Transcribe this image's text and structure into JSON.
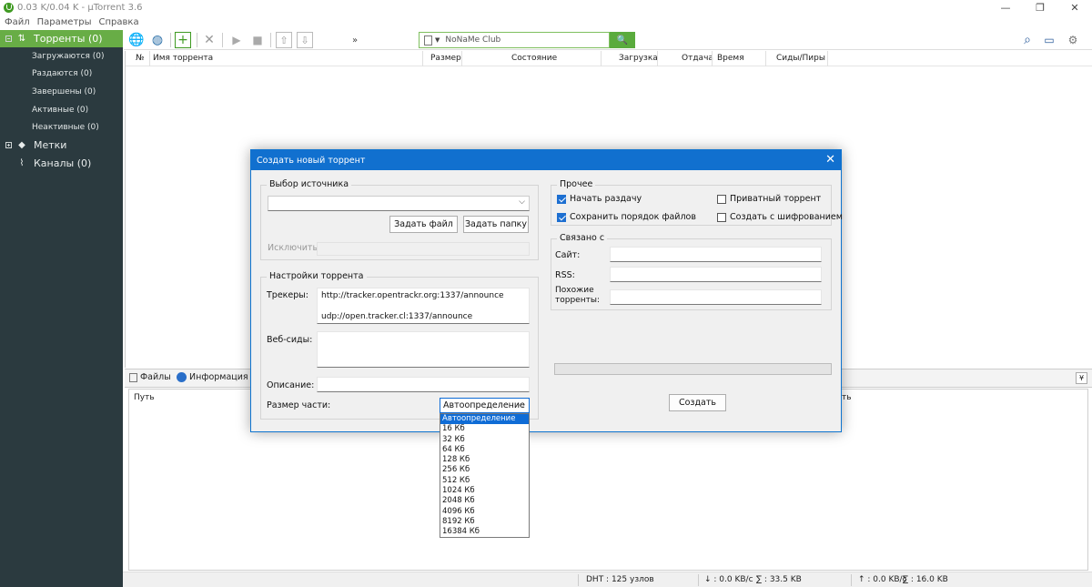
{
  "window": {
    "title": "0.03 K/0.04 K - µTorrent 3.6",
    "controls": [
      "—",
      "❐",
      "✕"
    ]
  },
  "menu": [
    "Файл",
    "Параметры",
    "Справка"
  ],
  "sidebar": {
    "torrents": "Торренты (0)",
    "subitems": [
      "Загружаются (0)",
      "Раздаются (0)",
      "Завершены (0)",
      "Активные (0)",
      "Неактивные (0)"
    ],
    "labels": "Метки",
    "feeds": "Каналы (0)"
  },
  "toolbar": {
    "search_value": "NoNaMe Club",
    "more": "»"
  },
  "list_columns": [
    "№",
    "Имя торрента",
    "Размер",
    "Состояние",
    "Загрузка",
    "Отдача",
    "Время",
    "Сиды/Пиры"
  ],
  "bottom_tabs": [
    "Файлы",
    "Информация"
  ],
  "files_columns": [
    "Путь",
    "ть"
  ],
  "status": {
    "dht": "DHT : 125 узлов",
    "down": "↓ : 0.0 KB/с",
    "down_total": "∑ : 33.5 KB",
    "up": "↑ : 0.0 KB/с",
    "up_total": "∑ : 16.0 KB"
  },
  "dialog": {
    "title": "Создать новый торрент",
    "source_group": "Выбор источника",
    "source_value": "",
    "btn_file": "Задать файл",
    "btn_folder": "Задать папку",
    "exclude_label": "Исключить:",
    "settings_group": "Настройки торрента",
    "trackers_label": "Трекеры:",
    "trackers": [
      "http://tracker.opentrackr.org:1337/announce",
      "udp://open.tracker.cl:1337/announce"
    ],
    "webseeds_label": "Веб-сиды:",
    "comment_label": "Описание:",
    "piece_label": "Размер части:",
    "piece_value": "Автоопределение",
    "other_group": "Прочее",
    "chk_start_seed": "Начать раздачу",
    "chk_keep_order": "Сохранить порядок файлов",
    "chk_private": "Приватный торрент",
    "chk_encrypt": "Создать с шифрованием",
    "related_group": "Связано с",
    "site_label": "Сайт:",
    "rss_label": "RSS:",
    "similar_label_1": "Похожие",
    "similar_label_2": "торренты:",
    "create_btn": "Создать"
  },
  "piece_sizes": [
    "Автоопределение",
    "16 Кб",
    "32 Кб",
    "64 Кб",
    "128 Кб",
    "256 Кб",
    "512 Кб",
    "1024 Кб",
    "2048 Кб",
    "4096 Кб",
    "8192 Кб",
    "16384 Кб"
  ],
  "colors": {
    "accent_green": "#68ad46",
    "sidebar_bg": "#2b3a3f",
    "dialog_title": "#1170cf",
    "selection_blue": "#0f6cd6"
  }
}
